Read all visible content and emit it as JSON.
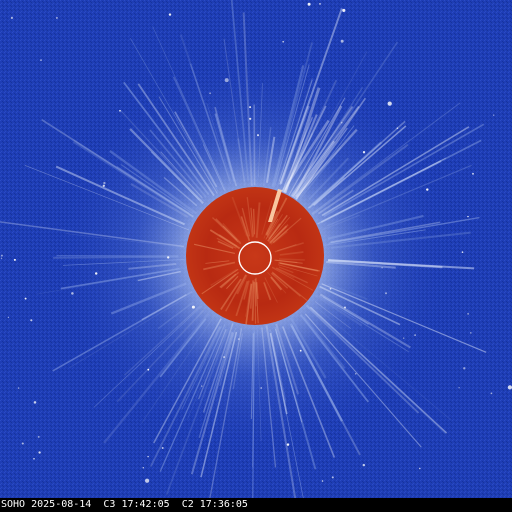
{
  "image": {
    "type": "SOHO LASCO C3/C2 composite coronagraph",
    "colors": {
      "sky_blue": "#1f3fb8",
      "occulter_red": "#b82a12",
      "corona_glow": "#d6e4ff",
      "caption_text": "#ffffff",
      "caption_bg": "#000000"
    }
  },
  "caption": {
    "observatory": "SOHO",
    "date": "2025-08-14",
    "c3_label": "C3",
    "c3_time": "17:42:05",
    "c2_label": "C2",
    "c2_time": "17:36:05"
  }
}
